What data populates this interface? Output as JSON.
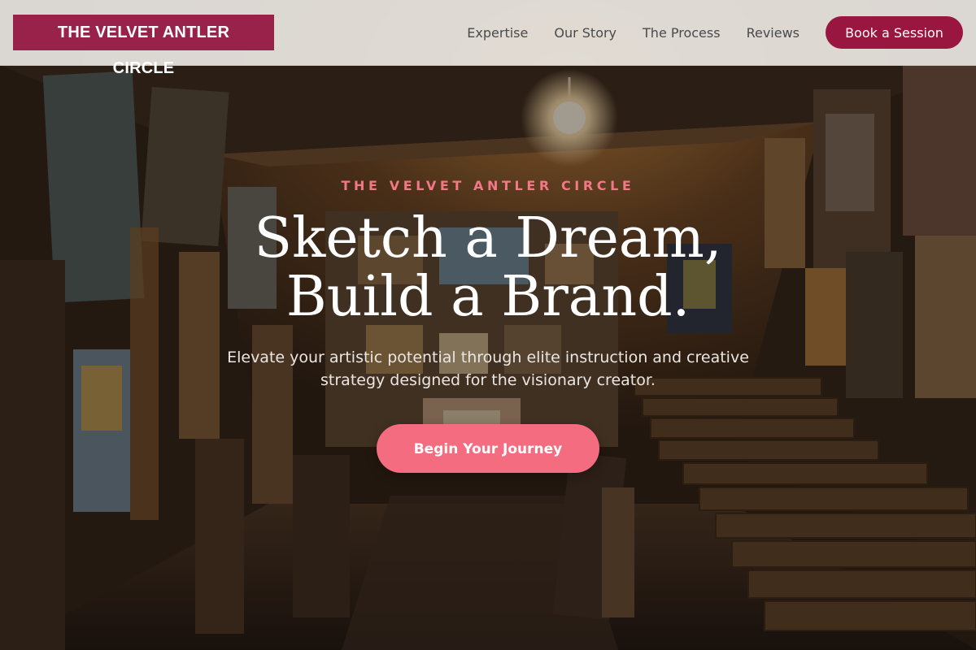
{
  "header": {
    "brand": "THE VELVET ANTLER CIRCLE",
    "nav": [
      {
        "label": "Expertise"
      },
      {
        "label": "Our Story"
      },
      {
        "label": "The Process"
      },
      {
        "label": "Reviews"
      }
    ],
    "cta_label": "Book a Session"
  },
  "hero": {
    "eyebrow": "THE VELVET ANTLER CIRCLE",
    "title_line1": "Sketch a Dream,",
    "title_line2": "Build a Brand.",
    "subtitle": "Elevate your artistic potential through elite instruction and creative strategy designed for the visionary creator.",
    "cta_label": "Begin Your Journey",
    "background": "art-studio-photo"
  },
  "colors": {
    "brand": "#98224a",
    "accent": "#f46c80",
    "header_bg": "#e8e5e1",
    "nav_text": "#4a4a4a",
    "hero_text": "#ffffff"
  }
}
